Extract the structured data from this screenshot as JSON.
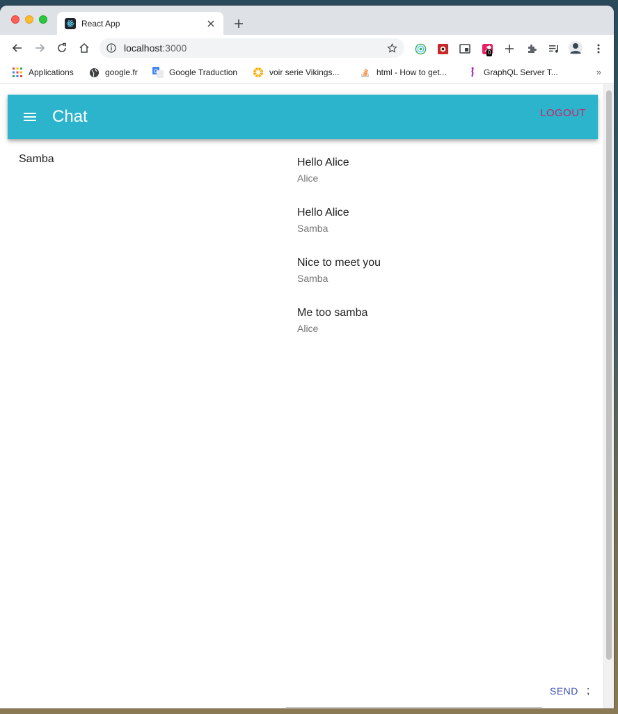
{
  "browser": {
    "tab": {
      "title": "React App"
    },
    "address": {
      "host": "localhost",
      "port": ":3000"
    },
    "extension_badge": "0",
    "bookmarks": [
      {
        "label": "Applications",
        "icon": "apps-grid-icon"
      },
      {
        "label": "google.fr",
        "icon": "globe-icon"
      },
      {
        "label": "Google Traduction",
        "icon": "translate-icon"
      },
      {
        "label": "voir serie Vikings...",
        "icon": "wheel-icon"
      },
      {
        "label": "html - How to get...",
        "icon": "stackoverflow-icon"
      },
      {
        "label": "GraphQL Server T...",
        "icon": "graphql-icon"
      }
    ],
    "bookmarks_overflow": "»"
  },
  "app": {
    "title": "Chat",
    "logout_label": "LOGOUT",
    "accent_color": "#2bb4cc",
    "logout_color": "#d81b60"
  },
  "users": [
    {
      "name": "Samba"
    }
  ],
  "messages": [
    {
      "text": "Hello Alice",
      "author": "Alice"
    },
    {
      "text": "Hello Alice",
      "author": "Samba"
    },
    {
      "text": "Nice to meet you",
      "author": "Samba"
    },
    {
      "text": "Me too samba",
      "author": "Alice"
    }
  ],
  "composer": {
    "value": "",
    "send_label": "SEND",
    "trailing_text": ";"
  }
}
